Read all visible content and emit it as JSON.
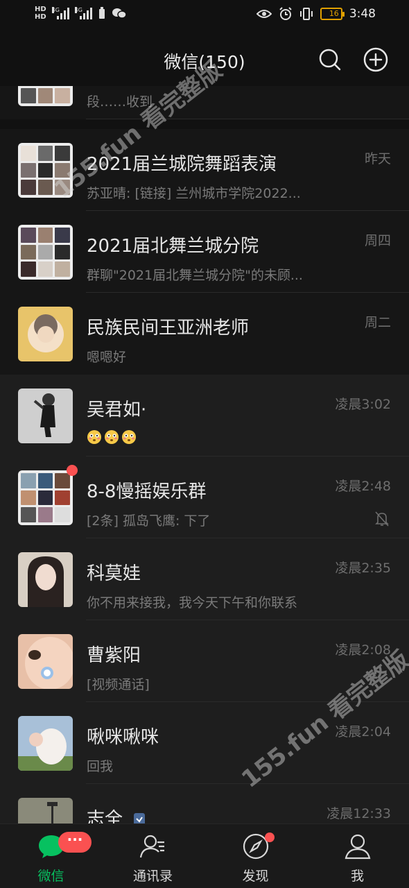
{
  "status_bar": {
    "hd1": "HD",
    "hd2": "HD",
    "net1": "4G",
    "net2": "4G",
    "battery": "16",
    "time": "3:48"
  },
  "header": {
    "title": "微信(150)"
  },
  "chats": [
    {
      "name": "",
      "preview": "段……收到",
      "time": ""
    },
    {
      "name": "2021届兰城院舞蹈表演",
      "preview": "苏亚晴: [链接] 兰州城市学院2022...",
      "time": "昨天"
    },
    {
      "name": "2021届北舞兰城分院",
      "preview": "群聊\"2021届北舞兰城分院\"的未顾...",
      "time": "周四"
    },
    {
      "name": "民族民间王亚洲老师",
      "preview": "嗯嗯好",
      "time": "周二"
    },
    {
      "name": "吴君如·",
      "preview": "",
      "time": "凌晨3:02"
    },
    {
      "name": "8-8慢摇娱乐群",
      "preview": "[2条] 孤岛飞鹰: 下了",
      "time": "凌晨2:48"
    },
    {
      "name": "科莫娃",
      "preview": "你不用来接我，我今天下午和你联系",
      "time": "凌晨2:35"
    },
    {
      "name": "曹紫阳",
      "preview": "[视频通话]",
      "time": "凌晨2:08"
    },
    {
      "name": "啾咪啾咪",
      "preview": "回我",
      "time": "凌晨2:04"
    },
    {
      "name": "志全",
      "preview": "",
      "time": "凌晨12:33"
    }
  ],
  "watermark": {
    "text": "155.fun 看完整版"
  },
  "tabs": [
    {
      "label": "微信",
      "badge": "···"
    },
    {
      "label": "通讯录"
    },
    {
      "label": "发现"
    },
    {
      "label": "我"
    }
  ],
  "colors": {
    "accent": "#07c160",
    "badge": "#fa5151",
    "background": "#111111"
  },
  "icons": [
    "search-icon",
    "add-icon",
    "mute-icon",
    "chat-icon",
    "contacts-icon",
    "compass-icon",
    "person-icon"
  ]
}
